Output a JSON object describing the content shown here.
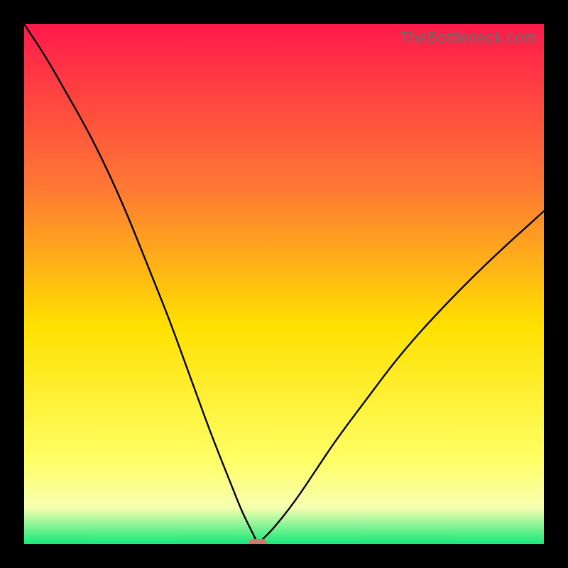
{
  "watermark": {
    "text": "TheBottleneck.com"
  },
  "colors": {
    "black": "#000000",
    "curve": "#000000",
    "marker": "#cf7a69",
    "grad_top": "#ff1a4b",
    "grad_mid1": "#ff7a33",
    "grad_mid2": "#ffe000",
    "grad_bottom_yellow": "#ffff66",
    "grad_pale": "#f7ffb0",
    "grad_green": "#17e87a"
  },
  "chart_data": {
    "type": "line",
    "title": "",
    "xlabel": "",
    "ylabel": "",
    "x_range": [
      0,
      100
    ],
    "y_range": [
      0,
      100
    ],
    "series": [
      {
        "name": "bottleneck-curve",
        "x": [
          0,
          4,
          8,
          12,
          16,
          20,
          24,
          28,
          32,
          36,
          40,
          42,
          44,
          45,
          46,
          48,
          52,
          56,
          60,
          66,
          72,
          80,
          90,
          100
        ],
        "y": [
          100,
          94,
          87,
          80,
          72,
          63,
          53,
          43,
          32,
          21,
          11,
          6,
          2,
          0,
          1,
          3,
          8,
          14,
          20,
          28,
          36,
          45,
          55,
          64
        ]
      }
    ],
    "marker": {
      "x": 45,
      "y": 0,
      "label": "optimal-point"
    },
    "gradient_stops": [
      {
        "offset": 0.0,
        "color": "#ff1a4b"
      },
      {
        "offset": 0.32,
        "color": "#ff7a33"
      },
      {
        "offset": 0.58,
        "color": "#ffe000"
      },
      {
        "offset": 0.84,
        "color": "#ffff66"
      },
      {
        "offset": 0.93,
        "color": "#f7ffb0"
      },
      {
        "offset": 1.0,
        "color": "#17e87a"
      }
    ]
  }
}
